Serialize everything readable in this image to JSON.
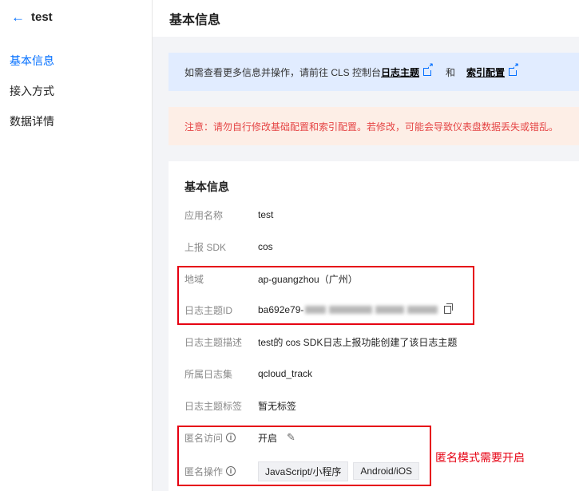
{
  "sidebar": {
    "back_label": "test",
    "items": [
      {
        "label": "基本信息",
        "active": true
      },
      {
        "label": "接入方式",
        "active": false
      },
      {
        "label": "数据详情",
        "active": false
      }
    ]
  },
  "header": {
    "title": "基本信息"
  },
  "info_alert": {
    "prefix": "如需查看更多信息并操作，请前往 CLS 控制台",
    "link1": "日志主题",
    "and": "和",
    "link2": "索引配置"
  },
  "warn_alert": {
    "text": "注意：请勿自行修改基础配置和索引配置。若修改，可能会导致仪表盘数据丢失或错乱。"
  },
  "card": {
    "title": "基本信息",
    "app_name": {
      "label": "应用名称",
      "value": "test"
    },
    "sdk": {
      "label": "上报 SDK",
      "value": "cos"
    },
    "region": {
      "label": "地域",
      "value": "ap-guangzhou（广州）"
    },
    "topic_id": {
      "label": "日志主题ID",
      "value_prefix": "ba692e79-"
    },
    "topic_desc": {
      "label": "日志主题描述",
      "value": "test的 cos SDK日志上报功能创建了该日志主题"
    },
    "logset": {
      "label": "所属日志集",
      "value": "qcloud_track"
    },
    "topic_tags": {
      "label": "日志主题标签",
      "value": "暂无标签"
    },
    "anon_access": {
      "label": "匿名访问",
      "value": "开启"
    },
    "anon_ops": {
      "label": "匿名操作",
      "tags": [
        "JavaScript/小程序",
        "Android/iOS"
      ]
    }
  },
  "annotation": {
    "text": "匿名模式需要开启",
    "color": "#e60012"
  },
  "colors": {
    "accent": "#006eff",
    "info_bg": "#e1ecff",
    "warn_bg": "#fdeee6",
    "warn_text": "#e54545"
  }
}
